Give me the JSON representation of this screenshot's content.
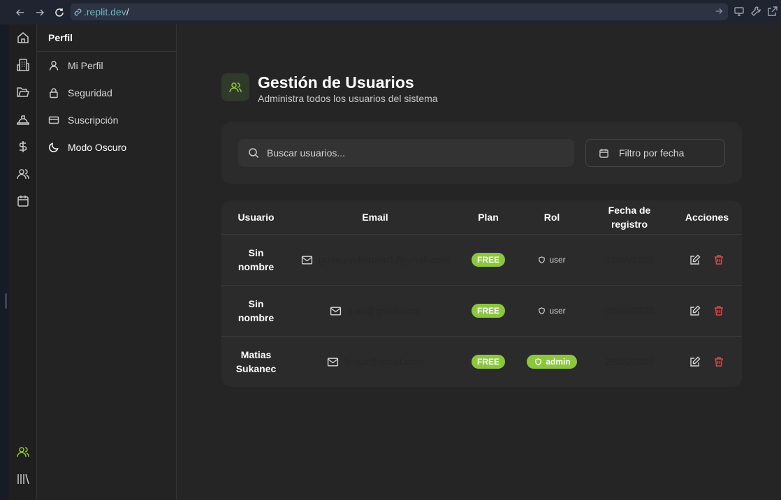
{
  "browser": {
    "url_host": ".replit.dev",
    "url_path": "/"
  },
  "sidebar": {
    "heading": "Perfil",
    "items": [
      {
        "label": "Mi Perfil",
        "icon": "user-icon"
      },
      {
        "label": "Seguridad",
        "icon": "lock-icon"
      },
      {
        "label": "Suscripción",
        "icon": "credit-card-icon"
      },
      {
        "label": "Modo Oscuro",
        "icon": "moon-icon"
      }
    ]
  },
  "rail": {
    "icons": [
      "home-icon",
      "building-icon",
      "folder-icon",
      "hard-hat-icon",
      "dollar-icon",
      "users-icon",
      "calendar-icon",
      "users-active-icon",
      "library-icon"
    ]
  },
  "header": {
    "title": "Gestión de Usuarios",
    "subtitle": "Administra todos los usuarios del sistema"
  },
  "filters": {
    "search_placeholder": "Buscar usuarios...",
    "date_label": "Filtro por fecha"
  },
  "table": {
    "columns": {
      "user": "Usuario",
      "email": "Email",
      "plan": "Plan",
      "role": "Rol",
      "date": "Fecha de registro",
      "actions": "Acciones"
    },
    "rows": [
      {
        "name": "Sin nombre",
        "email": "gomezvidalrocio1@gmail.com",
        "plan": "FREE",
        "role": "user",
        "date": "03/06/2025"
      },
      {
        "name": "Sin nombre",
        "email": "juan@gmail.com",
        "plan": "FREE",
        "role": "user",
        "date": "03/06/2025"
      },
      {
        "name": "Matias Sukanec",
        "email": "lenga@gmail.com",
        "plan": "FREE",
        "role": "admin",
        "date": "26/05/2025"
      }
    ]
  },
  "colors": {
    "accent": "#8cc63f",
    "danger": "#e04848",
    "background": "#252525",
    "card": "#2b2b2b"
  }
}
